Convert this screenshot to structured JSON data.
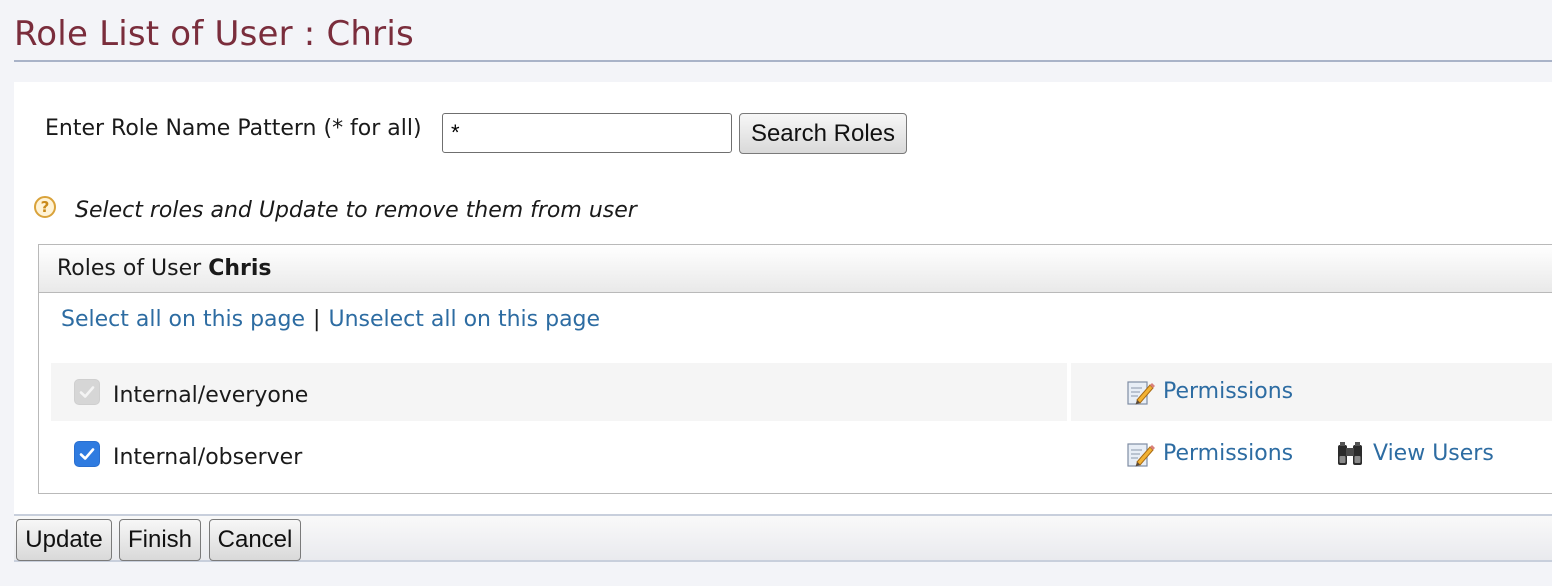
{
  "page": {
    "title": "Role List of User : Chris"
  },
  "search": {
    "label": "Enter Role Name Pattern (* for all)",
    "value": "*",
    "button_label": "Search Roles"
  },
  "help": {
    "icon": "help-icon",
    "text": "Select roles and Update to remove them from user"
  },
  "roles_table": {
    "header_prefix": "Roles of User",
    "header_user": "Chris",
    "select_all_label": "Select all on this page",
    "separator": "|",
    "unselect_all_label": "Unselect all on this page",
    "rows": [
      {
        "name": "Internal/everyone",
        "checked": true,
        "disabled": true,
        "permissions_label": "Permissions"
      },
      {
        "name": "Internal/observer",
        "checked": true,
        "disabled": false,
        "permissions_label": "Permissions",
        "view_users_label": "View Users"
      }
    ]
  },
  "footer": {
    "update_label": "Update",
    "finish_label": "Finish",
    "cancel_label": "Cancel"
  },
  "colors": {
    "title": "#7a2d3c",
    "link": "#2d6ca2",
    "checkbox_checked": "#2f7be0"
  }
}
